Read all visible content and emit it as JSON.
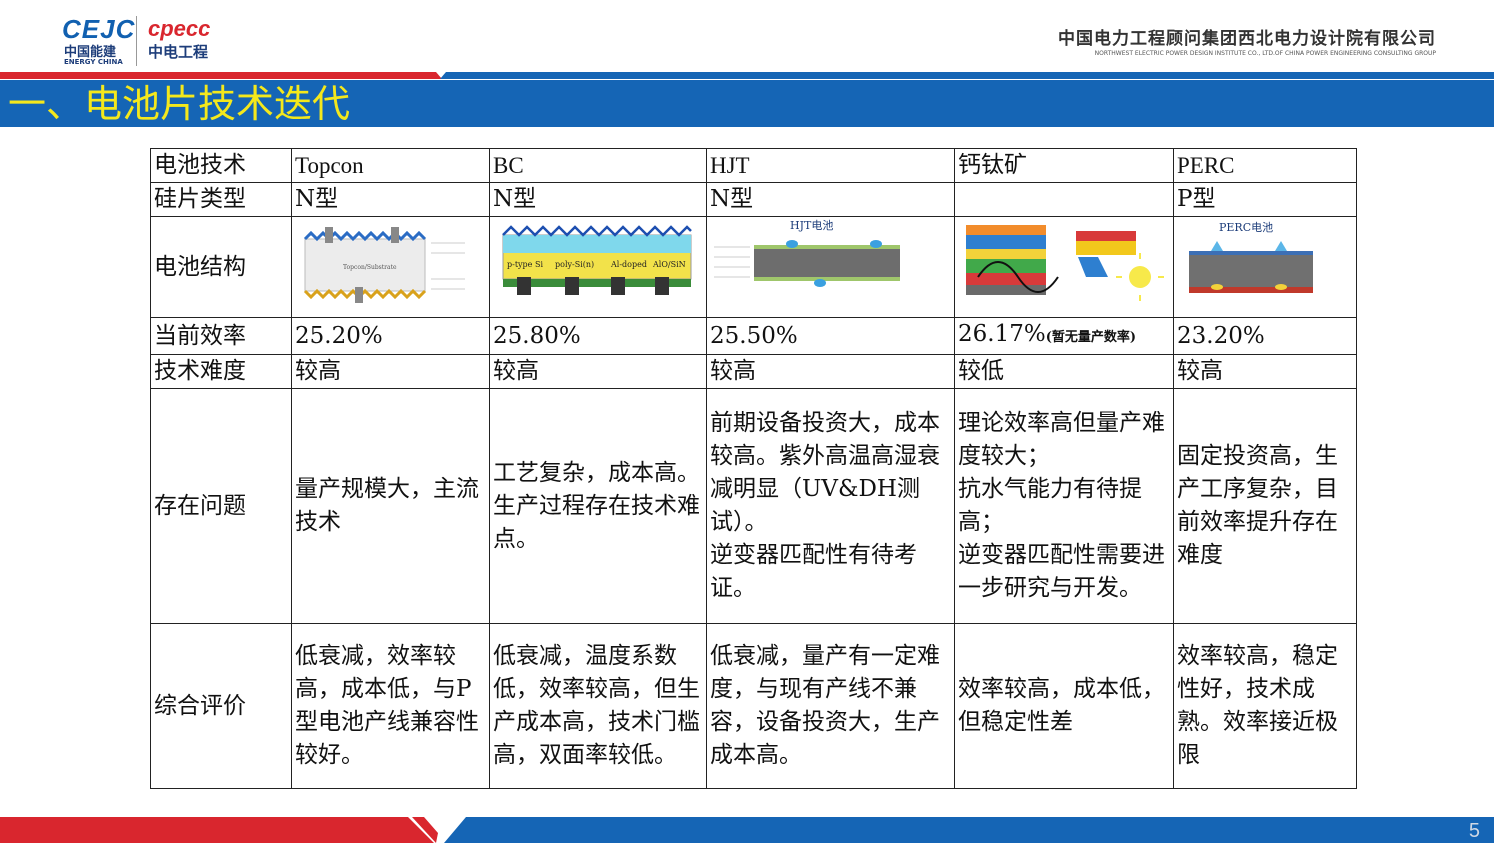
{
  "header": {
    "logo_left_brand": "CEJC",
    "logo_left_cn": "中国能建",
    "logo_left_en": "ENERGY CHINA",
    "logo_right_brand": "cpecc",
    "logo_right_cn": "中电工程",
    "company_cn": "中国电力工程顾问集团西北电力设计院有限公司",
    "company_en": "NORTHWEST ELECTRIC POWER DESIGN INSTITUTE CO., LTD.OF CHINA POWER ENGINEERING CONSULTING GROUP"
  },
  "title": "一、电池片技术迭代",
  "table": {
    "row_labels": {
      "tech": "电池技术",
      "wafer": "硅片类型",
      "structure": "电池结构",
      "efficiency": "当前效率",
      "difficulty": "技术难度",
      "issues": "存在问题",
      "evaluation": "综合评价"
    },
    "columns": [
      {
        "tech": "Topcon",
        "wafer": "N型",
        "efficiency": "25.20%",
        "efficiency_note": "",
        "difficulty": "较高",
        "issues": [
          "量产规模大，主流技术"
        ],
        "evaluation": [
          "低衰减，效率较高，成本低，与P型电池产线兼容性较好。"
        ],
        "diagram_title": "",
        "diagram_inner": "Topcon/Substrate"
      },
      {
        "tech": "BC",
        "wafer": "N型",
        "efficiency": "25.80%",
        "efficiency_note": "",
        "difficulty": "较高",
        "issues": [
          "工艺复杂，成本高。",
          "生产过程存在技术难点。"
        ],
        "evaluation": [
          "低衰减，温度系数低，效率较高，但生产成本高，技术门槛高，双面率较低。"
        ],
        "diagram_title": "",
        "diagram_labels": [
          "p-type Si",
          "poly-Si(n)",
          "Al-doped",
          "AlO/SiN"
        ]
      },
      {
        "tech": "HJT",
        "wafer": "N型",
        "efficiency": "25.50%",
        "efficiency_note": "",
        "difficulty": "较高",
        "issues": [
          "前期设备投资大，成本较高。紫外高温高湿衰减明显（UV&DH测试）。",
          "逆变器匹配性有待考证。"
        ],
        "evaluation": [
          "低衰减，量产有一定难度，与现有产线不兼容，设备投资大，生产成本高。"
        ],
        "diagram_title": "HJT电池"
      },
      {
        "tech": "钙钛矿",
        "wafer": "",
        "efficiency": "26.17%",
        "efficiency_note": "(暂无量产数率)",
        "difficulty": "较低",
        "issues": [
          "理论效率高但量产难度较大；",
          "抗水气能力有待提高；",
          "逆变器匹配性需要进一步研究与开发。"
        ],
        "evaluation": [
          "效率较高，成本低，但稳定性差"
        ],
        "diagram_title": ""
      },
      {
        "tech": "PERC",
        "wafer": "P型",
        "efficiency": "23.20%",
        "efficiency_note": "",
        "difficulty": "较高",
        "issues": [
          "固定投资高，生产工序复杂，目前效率提升存在难度"
        ],
        "evaluation": [
          "效率较高，稳定性好，技术成熟。效率接近极限"
        ],
        "diagram_title": "PERC电池"
      }
    ]
  },
  "page_number": "5",
  "colors": {
    "brand_blue": "#1565b5",
    "brand_red": "#d9262e",
    "title_yellow": "#f4e81c"
  }
}
